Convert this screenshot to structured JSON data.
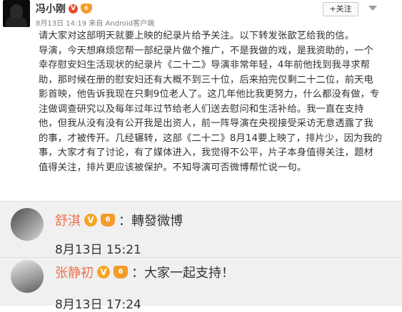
{
  "post": {
    "author": "冯小刚",
    "verified_badge": "V",
    "member_badge": "6",
    "meta": "8月13日 14:19 来自 Android客户端",
    "follow_label": "+关注",
    "text_lines": [
      "请大家对这部明天就要上映的纪录片给予关注。以下转发张歆艺给我的信。",
      "导演，今天想麻烦您帮一部纪录片做个推广，不是我做的戏，是我资助的，一个",
      "幸存慰安妇生活现状的纪录片《二十二》导演非常年轻，4年前他找到我寻求帮",
      "助，那时候在册的慰安妇还有大概不到三十位，后来拍完仅剩二十二位，前天电",
      "影首映，他告诉我现在只剩9位老人了。这几年他比我更努力，什么都没有做，专",
      "注做调查研究以及每年过年过节给老人们送去慰问和生活补给。我一直在支持",
      "他，但我从没有没有公开我是出资人，前一阵导演在央视接受采访无意透露了我",
      "的事，才被传开。几经辗转，这部《二十二》8月14要上映了，排片少，因为我的",
      "事，大家才有了讨论，有了媒体进入，我觉得不公平，片子本身值得关注，题材",
      "值得关注，排片更应该被保护。不知导演可否微博帮忙说一句。"
    ]
  },
  "comments": [
    {
      "name": "舒淇",
      "verified_badge": "V",
      "member_badge": "6",
      "text": "：轉發微博",
      "time": "8月13日 15:21"
    },
    {
      "name": "张静初",
      "verified_badge": "V",
      "member_badge": "6",
      "text": "：大家一起支持！",
      "time": "8月13日 17:24"
    }
  ],
  "colors": {
    "verified": "#f6a623",
    "name_link": "#eb7350",
    "follow_plus": "#ff8200"
  }
}
